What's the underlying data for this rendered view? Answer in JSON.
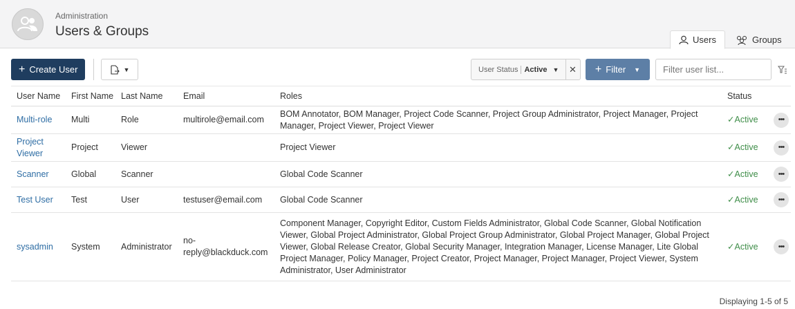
{
  "header": {
    "breadcrumb": "Administration",
    "title": "Users & Groups",
    "tabs": [
      {
        "label": "Users",
        "active": true
      },
      {
        "label": "Groups",
        "active": false
      }
    ]
  },
  "toolbar": {
    "create_label": "Create User",
    "status_filter": {
      "label": "User Status",
      "value": "Active"
    },
    "filter_label": "Filter",
    "search_placeholder": "Filter user list..."
  },
  "table": {
    "columns": [
      "User Name",
      "First Name",
      "Last Name",
      "Email",
      "Roles",
      "Status"
    ],
    "rows": [
      {
        "username": "Multi-role",
        "first": "Multi",
        "last": "Role",
        "email": "multirole@email.com",
        "roles": "BOM Annotator, BOM Manager, Project Code Scanner, Project Group Administrator, Project Manager, Project Manager, Project Viewer, Project Viewer",
        "status": "Active"
      },
      {
        "username": "Project Viewer",
        "first": "Project",
        "last": "Viewer",
        "email": "",
        "roles": "Project Viewer",
        "status": "Active"
      },
      {
        "username": "Scanner",
        "first": "Global",
        "last": "Scanner",
        "email": "",
        "roles": "Global Code Scanner",
        "status": "Active"
      },
      {
        "username": "Test User",
        "first": "Test",
        "last": "User",
        "email": "testuser@email.com",
        "roles": "Global Code Scanner",
        "status": "Active"
      },
      {
        "username": "sysadmin",
        "first": "System",
        "last": "Administrator",
        "email": "no-reply@blackduck.com",
        "roles": "Component Manager, Copyright Editor, Custom Fields Administrator, Global Code Scanner, Global Notification Viewer, Global Project Administrator, Global Project Group Administrator, Global Project Manager, Global Project Viewer, Global Release Creator, Global Security Manager, Integration Manager, License Manager, Lite Global Project Manager, Policy Manager, Project Creator, Project Manager, Project Manager, Project Viewer, System Administrator, User Administrator",
        "status": "Active"
      }
    ]
  },
  "footer": {
    "display_count": "Displaying 1-5 of 5"
  },
  "colors": {
    "primary": "#1f3d5f",
    "filter": "#5d7fa6",
    "link": "#2e6da4",
    "status_active": "#3e8d48"
  },
  "icons": [
    "users-group-avatar-icon",
    "user-icon",
    "groups-icon",
    "plus-icon",
    "export-icon",
    "caret-down-icon",
    "close-icon",
    "column-filter-icon",
    "check-icon",
    "more-icon"
  ]
}
